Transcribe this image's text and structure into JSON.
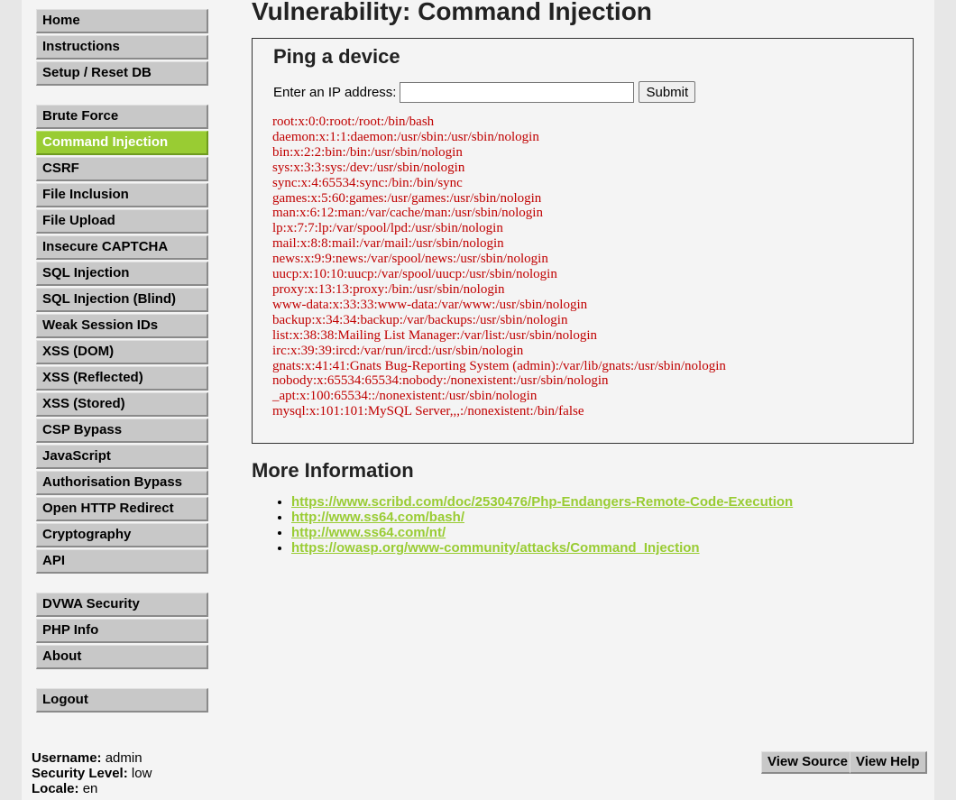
{
  "sidebar": {
    "group1": [
      "Home",
      "Instructions",
      "Setup / Reset DB"
    ],
    "group2": [
      "Brute Force",
      "Command Injection",
      "CSRF",
      "File Inclusion",
      "File Upload",
      "Insecure CAPTCHA",
      "SQL Injection",
      "SQL Injection (Blind)",
      "Weak Session IDs",
      "XSS (DOM)",
      "XSS (Reflected)",
      "XSS (Stored)",
      "CSP Bypass",
      "JavaScript",
      "Authorisation Bypass",
      "Open HTTP Redirect",
      "Cryptography",
      "API"
    ],
    "group3": [
      "DVWA Security",
      "PHP Info",
      "About"
    ],
    "group4": [
      "Logout"
    ],
    "selected": "Command Injection"
  },
  "main": {
    "title": "Vulnerability: Command Injection",
    "box_title": "Ping a device",
    "ip_label": "Enter an IP address:",
    "ip_value": "",
    "submit_label": "Submit",
    "output_lines": [
      "root:x:0:0:root:/root:/bin/bash",
      "daemon:x:1:1:daemon:/usr/sbin:/usr/sbin/nologin",
      "bin:x:2:2:bin:/bin:/usr/sbin/nologin",
      "sys:x:3:3:sys:/dev:/usr/sbin/nologin",
      "sync:x:4:65534:sync:/bin:/bin/sync",
      "games:x:5:60:games:/usr/games:/usr/sbin/nologin",
      "man:x:6:12:man:/var/cache/man:/usr/sbin/nologin",
      "lp:x:7:7:lp:/var/spool/lpd:/usr/sbin/nologin",
      "mail:x:8:8:mail:/var/mail:/usr/sbin/nologin",
      "news:x:9:9:news:/var/spool/news:/usr/sbin/nologin",
      "uucp:x:10:10:uucp:/var/spool/uucp:/usr/sbin/nologin",
      "proxy:x:13:13:proxy:/bin:/usr/sbin/nologin",
      "www-data:x:33:33:www-data:/var/www:/usr/sbin/nologin",
      "backup:x:34:34:backup:/var/backups:/usr/sbin/nologin",
      "list:x:38:38:Mailing List Manager:/var/list:/usr/sbin/nologin",
      "irc:x:39:39:ircd:/var/run/ircd:/usr/sbin/nologin",
      "gnats:x:41:41:Gnats Bug-Reporting System (admin):/var/lib/gnats:/usr/sbin/nologin",
      "nobody:x:65534:65534:nobody:/nonexistent:/usr/sbin/nologin",
      "_apt:x:100:65534::/nonexistent:/usr/sbin/nologin",
      "mysql:x:101:101:MySQL Server,,,:/nonexistent:/bin/false"
    ],
    "more_info_title": "More Information",
    "links": [
      "https://www.scribd.com/doc/2530476/Php-Endangers-Remote-Code-Execution",
      "http://www.ss64.com/bash/",
      "http://www.ss64.com/nt/",
      "https://owasp.org/www-community/attacks/Command_Injection"
    ]
  },
  "footer": {
    "view_source_label": "View Source",
    "view_help_label": "View Help",
    "username_label": "Username:",
    "username_value": "admin",
    "security_label": "Security Level:",
    "security_value": "low",
    "locale_label": "Locale:",
    "locale_value": "en"
  },
  "colors": {
    "accent": "#99cc33",
    "output_text": "#c00000",
    "page_bg": "#e7e7e7",
    "content_bg": "#f4f4f4"
  }
}
